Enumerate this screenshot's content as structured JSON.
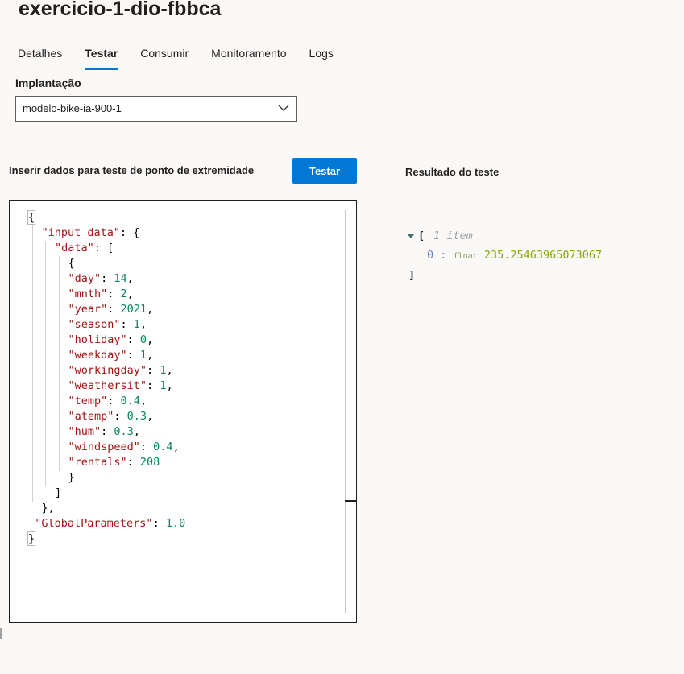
{
  "header": {
    "title": "exercicio-1-dio-fbbca"
  },
  "tabs": [
    {
      "label": "Detalhes",
      "active": false
    },
    {
      "label": "Testar",
      "active": true
    },
    {
      "label": "Consumir",
      "active": false
    },
    {
      "label": "Monitoramento",
      "active": false
    },
    {
      "label": "Logs",
      "active": false
    }
  ],
  "deployment": {
    "label": "Implantação",
    "selected": "modelo-bike-ia-900-1",
    "icon": "chevron-down-icon"
  },
  "input_panel": {
    "label": "Inserir dados para teste de ponto de extremidade",
    "button_label": "Testar",
    "code_lines": [
      {
        "indent": 0,
        "parts": [
          [
            "p",
            "{"
          ]
        ]
      },
      {
        "indent": 1,
        "parts": [
          [
            "k",
            "\"input_data\""
          ],
          [
            "p",
            ": {"
          ]
        ]
      },
      {
        "indent": 2,
        "parts": [
          [
            "k",
            "\"data\""
          ],
          [
            "p",
            ": ["
          ]
        ]
      },
      {
        "indent": 3,
        "parts": [
          [
            "p",
            "{"
          ]
        ]
      },
      {
        "indent": 3,
        "parts": [
          [
            "k",
            "\"day\""
          ],
          [
            "p",
            ": "
          ],
          [
            "n",
            "14"
          ],
          [
            "p",
            ","
          ]
        ]
      },
      {
        "indent": 3,
        "parts": [
          [
            "k",
            "\"mnth\""
          ],
          [
            "p",
            ": "
          ],
          [
            "n",
            "2"
          ],
          [
            "p",
            ","
          ]
        ]
      },
      {
        "indent": 3,
        "parts": [
          [
            "k",
            "\"year\""
          ],
          [
            "p",
            ": "
          ],
          [
            "n",
            "2021"
          ],
          [
            "p",
            ","
          ]
        ]
      },
      {
        "indent": 3,
        "parts": [
          [
            "k",
            "\"season\""
          ],
          [
            "p",
            ": "
          ],
          [
            "n",
            "1"
          ],
          [
            "p",
            ","
          ]
        ]
      },
      {
        "indent": 3,
        "parts": [
          [
            "k",
            "\"holiday\""
          ],
          [
            "p",
            ": "
          ],
          [
            "n",
            "0"
          ],
          [
            "p",
            ","
          ]
        ]
      },
      {
        "indent": 3,
        "parts": [
          [
            "k",
            "\"weekday\""
          ],
          [
            "p",
            ": "
          ],
          [
            "n",
            "1"
          ],
          [
            "p",
            ","
          ]
        ]
      },
      {
        "indent": 3,
        "parts": [
          [
            "k",
            "\"workingday\""
          ],
          [
            "p",
            ": "
          ],
          [
            "n",
            "1"
          ],
          [
            "p",
            ","
          ]
        ]
      },
      {
        "indent": 3,
        "parts": [
          [
            "k",
            "\"weathersit\""
          ],
          [
            "p",
            ": "
          ],
          [
            "n",
            "1"
          ],
          [
            "p",
            ","
          ]
        ]
      },
      {
        "indent": 3,
        "parts": [
          [
            "k",
            "\"temp\""
          ],
          [
            "p",
            ": "
          ],
          [
            "n",
            "0.4"
          ],
          [
            "p",
            ","
          ]
        ]
      },
      {
        "indent": 3,
        "parts": [
          [
            "k",
            "\"atemp\""
          ],
          [
            "p",
            ": "
          ],
          [
            "n",
            "0.3"
          ],
          [
            "p",
            ","
          ]
        ]
      },
      {
        "indent": 3,
        "parts": [
          [
            "k",
            "\"hum\""
          ],
          [
            "p",
            ": "
          ],
          [
            "n",
            "0.3"
          ],
          [
            "p",
            ","
          ]
        ]
      },
      {
        "indent": 3,
        "parts": [
          [
            "k",
            "\"windspeed\""
          ],
          [
            "p",
            ": "
          ],
          [
            "n",
            "0.4"
          ],
          [
            "p",
            ","
          ]
        ]
      },
      {
        "indent": 3,
        "parts": [
          [
            "k",
            "\"rentals\""
          ],
          [
            "p",
            ": "
          ],
          [
            "n",
            "208"
          ]
        ]
      },
      {
        "indent": 3,
        "parts": [
          [
            "p",
            "}"
          ]
        ]
      },
      {
        "indent": 2,
        "parts": [
          [
            "p",
            "]"
          ]
        ]
      },
      {
        "indent": 1,
        "parts": [
          [
            "p",
            "},"
          ]
        ]
      },
      {
        "indent": 0.5,
        "parts": [
          [
            "k",
            "\"GlobalParameters\""
          ],
          [
            "p",
            ": "
          ],
          [
            "n",
            "1.0"
          ]
        ]
      },
      {
        "indent": 0,
        "parts": [
          [
            "p",
            "}"
          ]
        ]
      }
    ]
  },
  "result_panel": {
    "label": "Resultado do teste",
    "open_bracket": "[",
    "close_bracket": "]",
    "item_count": "1 item",
    "items": [
      {
        "index": "0",
        "separator": ":",
        "type": "float",
        "value": "235.25463965073067"
      }
    ]
  }
}
